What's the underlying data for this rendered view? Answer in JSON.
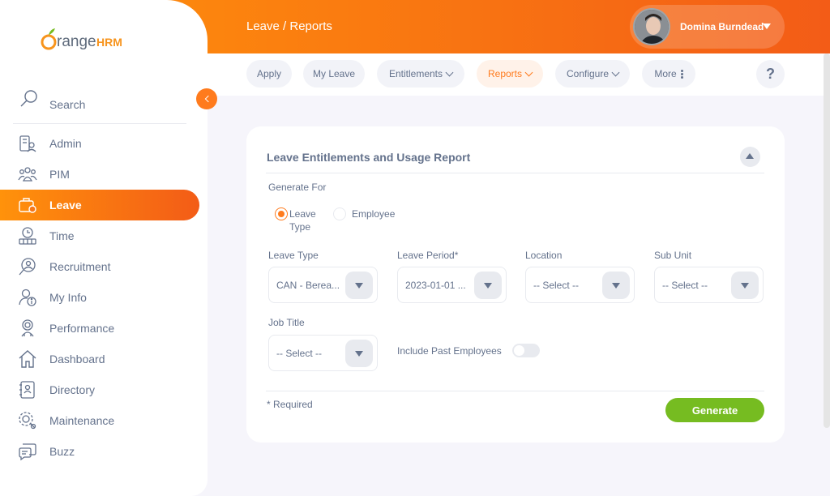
{
  "header": {
    "breadcrumb": "Leave / Reports",
    "user_name": "Domina Burndead"
  },
  "nav": {
    "tabs": [
      {
        "label": "Apply"
      },
      {
        "label": "My Leave"
      },
      {
        "label": "Entitlements"
      },
      {
        "label": "Reports",
        "active": true
      },
      {
        "label": "Configure"
      },
      {
        "label": "More"
      }
    ],
    "help": "?"
  },
  "sidebar": {
    "logo_orange": "Orange",
    "logo_hrm": "HRM",
    "search_label": "Search",
    "items": [
      {
        "label": "Admin",
        "icon": "admin-icon"
      },
      {
        "label": "PIM",
        "icon": "pim-icon"
      },
      {
        "label": "Leave",
        "icon": "leave-icon",
        "active": true
      },
      {
        "label": "Time",
        "icon": "time-icon"
      },
      {
        "label": "Recruitment",
        "icon": "recruitment-icon"
      },
      {
        "label": "My Info",
        "icon": "my-info-icon"
      },
      {
        "label": "Performance",
        "icon": "performance-icon"
      },
      {
        "label": "Dashboard",
        "icon": "dashboard-icon"
      },
      {
        "label": "Directory",
        "icon": "directory-icon"
      },
      {
        "label": "Maintenance",
        "icon": "maintenance-icon"
      },
      {
        "label": "Buzz",
        "icon": "buzz-icon"
      }
    ]
  },
  "report": {
    "title": "Leave Entitlements and Usage Report",
    "generate_for_label": "Generate For",
    "radio_leave_type_line1": "Leave",
    "radio_leave_type_line2": "Type",
    "radio_employee": "Employee",
    "leave_type_label": "Leave Type",
    "leave_type_value": "CAN - Berea...",
    "leave_period_label": "Leave Period*",
    "leave_period_value": "2023-01-01 ...",
    "location_label": "Location",
    "location_value": "-- Select --",
    "sub_unit_label": "Sub Unit",
    "sub_unit_value": "-- Select --",
    "job_title_label": "Job Title",
    "job_title_value": "-- Select --",
    "include_past_label": "Include Past Employees",
    "include_past_on": false,
    "required_note": "* Required",
    "generate_label": "Generate"
  },
  "colors": {
    "accent": "#ff7b1d",
    "generate_green": "#76bc21",
    "text": "#64728c"
  }
}
